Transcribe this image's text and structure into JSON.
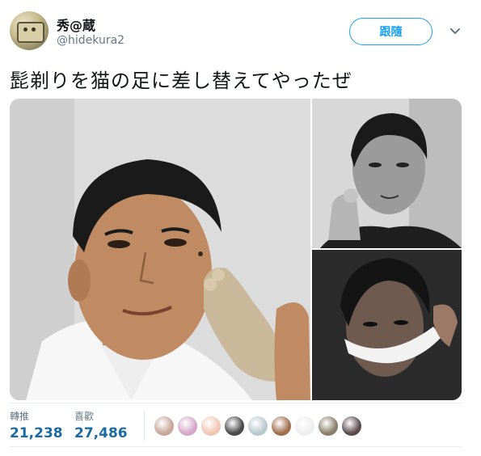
{
  "user": {
    "display_name": "秀@蔵",
    "handle": "@hidekura2"
  },
  "follow_button": {
    "label": "跟隨"
  },
  "menu_icon": "chevron-down-icon",
  "tweet": {
    "text": "髭剃りを猫の足に差し替えてやったぜ"
  },
  "stats": {
    "retweets": {
      "label": "轉推",
      "value": "21,238"
    },
    "likes": {
      "label": "喜歡",
      "value": "27,486"
    }
  },
  "likers": [
    {
      "color": "#c7a79a"
    },
    {
      "color": "#d5a6c9"
    },
    {
      "color": "#f2c6b4"
    },
    {
      "color": "#4a4a4a"
    },
    {
      "color": "#b8c9cf"
    },
    {
      "color": "#a06e4d"
    },
    {
      "color": "#eeeeee"
    },
    {
      "color": "#8a7f6a"
    },
    {
      "color": "#5c4a4f"
    }
  ],
  "colors": {
    "accent": "#1da1f2",
    "stat_value": "#1b6aa3",
    "muted": "#657786"
  }
}
